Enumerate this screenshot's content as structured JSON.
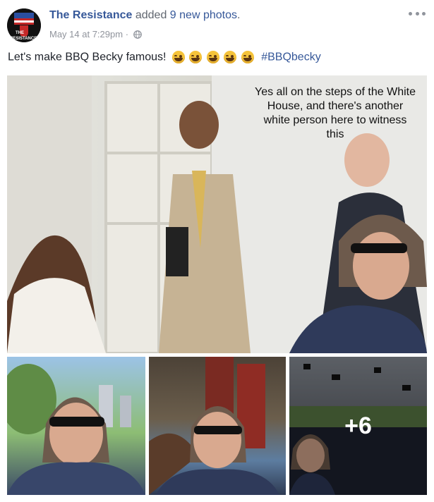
{
  "author": {
    "name": "The Resistance",
    "action_prefix": "added",
    "photo_count_text": "9 new photos",
    "action_suffix": ".",
    "avatar_text_1": "THE",
    "avatar_text_2": "RESISTANCE"
  },
  "meta": {
    "timestamp": "May 14 at 7:29pm",
    "separator": "·",
    "audience_icon": "globe-icon"
  },
  "post": {
    "text_before": "Let's make BBQ Becky famous!",
    "emoji": "face-with-tears-of-joy",
    "emoji_count": 5,
    "hashtag": "#BBQbecky"
  },
  "photos": {
    "main_caption": "Yes all on the steps of the White House, and there's another white person here to witness this",
    "more_count": "+6"
  },
  "colors": {
    "link": "#365899",
    "text": "#1d2129",
    "meta": "#90949c"
  }
}
